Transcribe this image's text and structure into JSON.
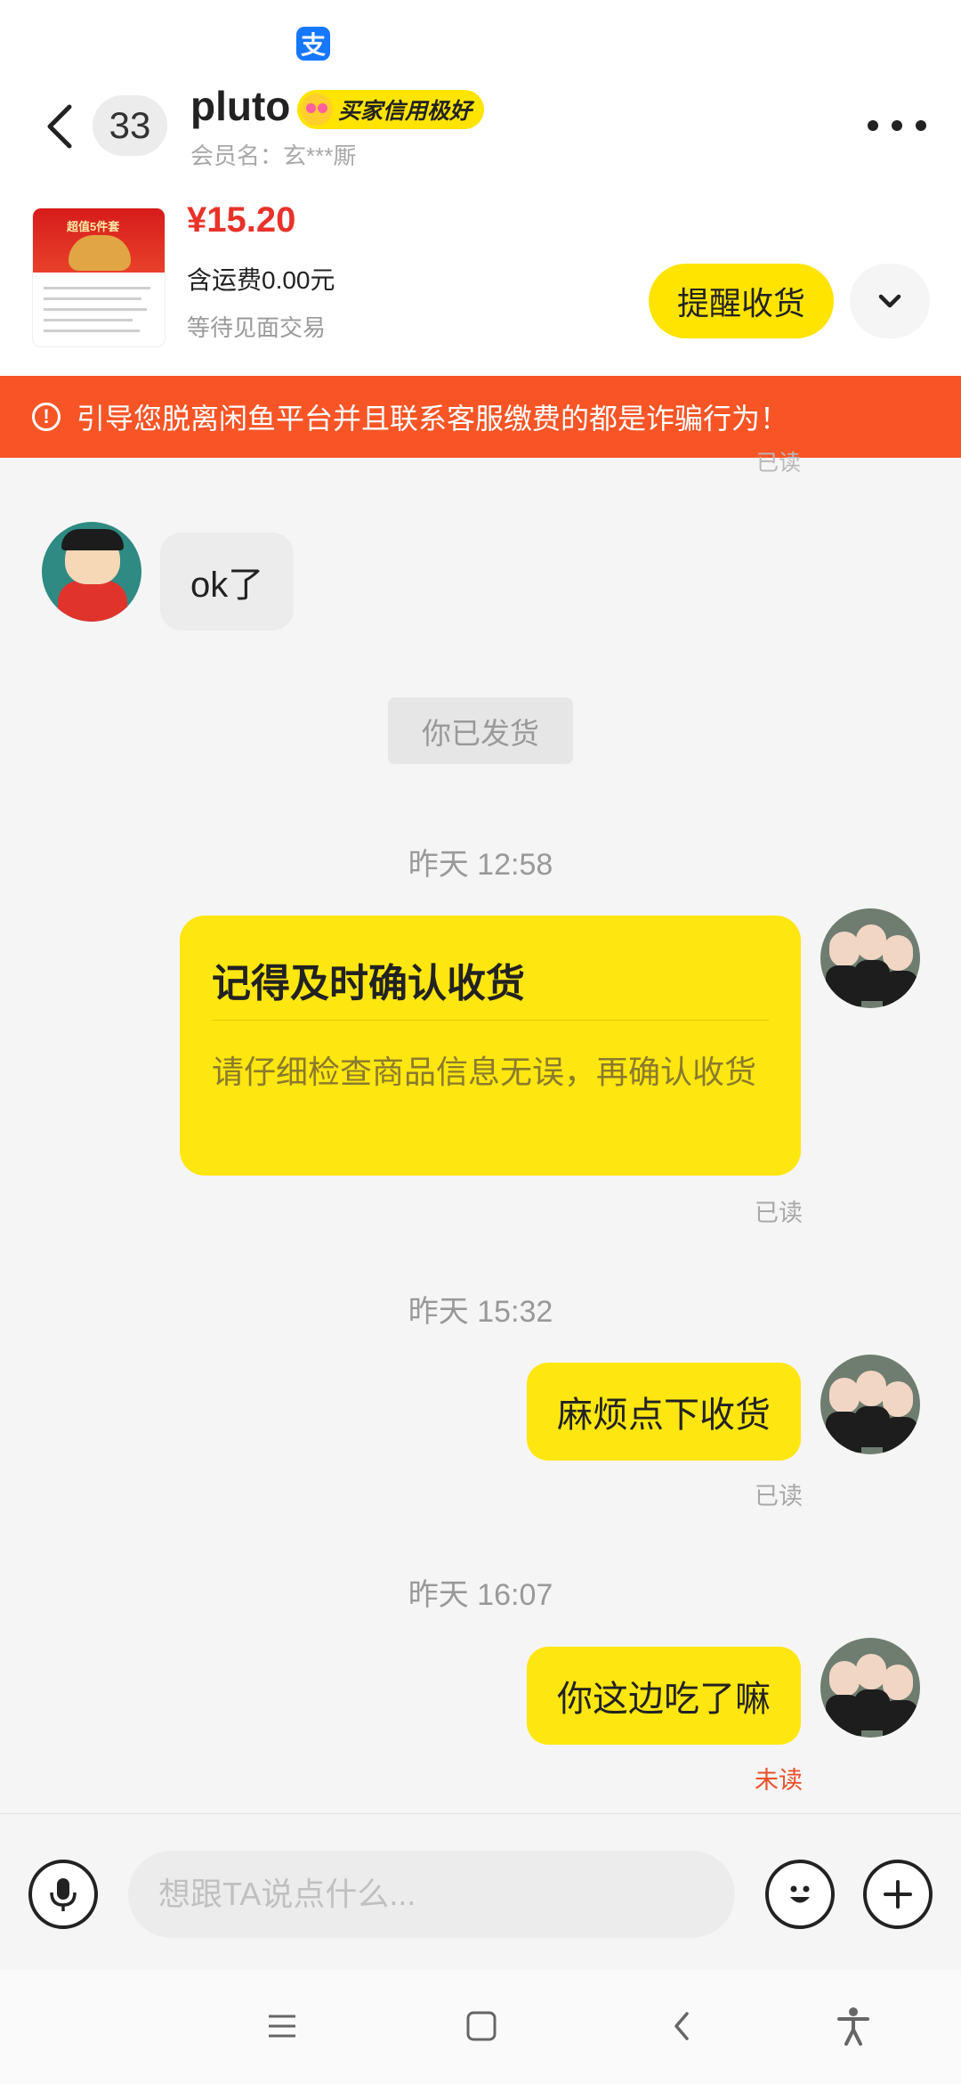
{
  "status_bar": {
    "app_icon": "alipay-icon",
    "app_icon_glyph": "支"
  },
  "header": {
    "back_icon": "back-arrow-icon",
    "unread_count": "33",
    "contact_name": "pluto",
    "credit_badge": "买家信用极好",
    "member_label": "会员名：玄***厮",
    "more_icon": "more-dots-icon"
  },
  "product": {
    "thumb_title": "超值5件套",
    "price": "¥15.20",
    "shipping": "含运费0.00元",
    "trade_status": "等待见面交易",
    "remind_button": "提醒收货",
    "expand_icon": "chevron-down-icon"
  },
  "warning": {
    "icon": "exclamation-circle-icon",
    "text": "引导您脱离闲鱼平台并且联系客服缴费的都是诈骗行为！"
  },
  "chat": {
    "faint_read": "已读",
    "incoming_text": "ok了",
    "system_message": "你已发货",
    "ts1": "昨天 12:58",
    "card_title": "记得及时确认收货",
    "card_text": "请仔细检查商品信息无误，再确认收货",
    "card_read": "已读",
    "ts2": "昨天 15:32",
    "msg2": "麻烦点下收货",
    "msg2_read": "已读",
    "ts3": "昨天 16:07",
    "msg3": "你这边吃了嘛",
    "msg3_status": "未读"
  },
  "input_bar": {
    "voice_icon": "microphone-icon",
    "placeholder": "想跟TA说点什么...",
    "emoji_icon": "emoji-icon",
    "plus_icon": "plus-icon"
  },
  "nav_bar": {
    "menu_icon": "menu-icon",
    "home_icon": "home-square-icon",
    "back_icon": "nav-back-icon",
    "accessibility_icon": "accessibility-icon"
  },
  "colors": {
    "brand_yellow": "#fee610",
    "warning_orange": "#f75526",
    "price_red": "#e8322a"
  }
}
